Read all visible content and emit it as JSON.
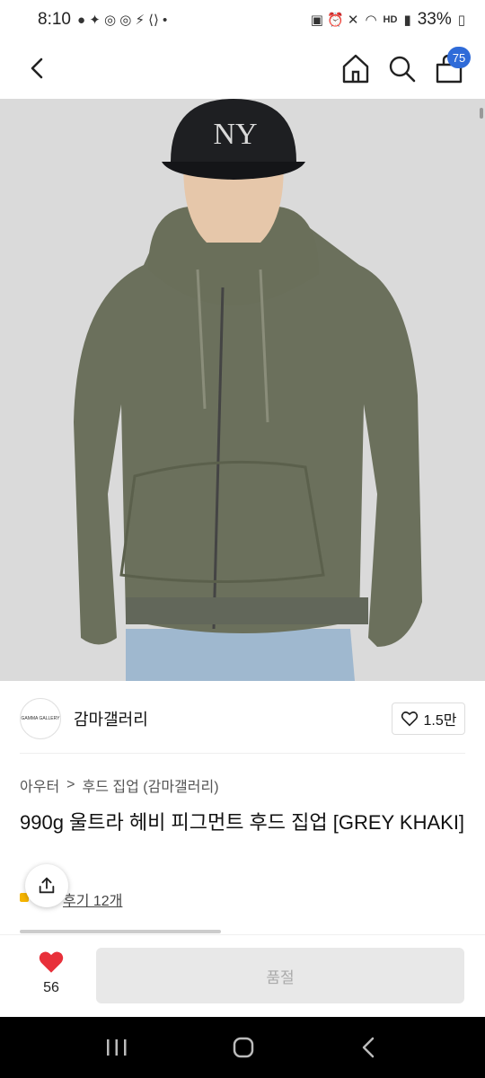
{
  "status_bar": {
    "time": "8:10",
    "battery": "33%",
    "hd_label": "HD"
  },
  "header": {
    "cart_count": "75",
    "icons": [
      "back-icon",
      "home-icon",
      "search-icon",
      "bag-icon"
    ]
  },
  "brand": {
    "logo_text": "GAMMA GALLERY",
    "name": "감마갤러리",
    "likes": "1.5만"
  },
  "breadcrumb": {
    "level1": "아우터",
    "separator": ">",
    "level2": "후드 집업 (감마갤러리)"
  },
  "product": {
    "title": "990g 울트라 헤비 피그먼트 후드 집업 [GREY KHAKI]",
    "reviews": "후기 12개"
  },
  "bottom": {
    "heart_count": "56",
    "soldout_label": "품절",
    "heart_color": "#e8303a"
  }
}
